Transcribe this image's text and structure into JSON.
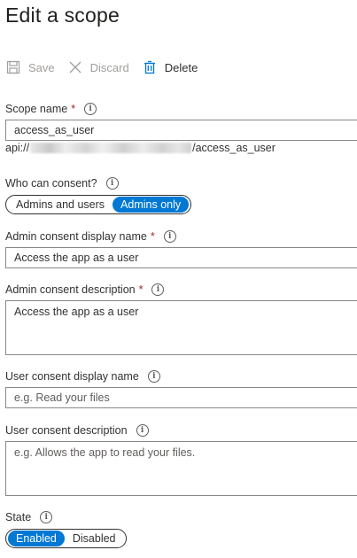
{
  "page": {
    "title": "Edit a scope"
  },
  "toolbar": {
    "save_label": "Save",
    "discard_label": "Discard",
    "delete_label": "Delete"
  },
  "scope_name": {
    "label": "Scope name",
    "required_mark": "*",
    "value": "access_as_user",
    "uri_prefix": "api://",
    "uri_suffix": "/access_as_user"
  },
  "who_can_consent": {
    "label": "Who can consent?",
    "options": [
      "Admins and users",
      "Admins only"
    ],
    "selected": "Admins only"
  },
  "admin_display_name": {
    "label": "Admin consent display name",
    "required_mark": "*",
    "value": "Access the app as a user"
  },
  "admin_description": {
    "label": "Admin consent description",
    "required_mark": "*",
    "value": "Access the app as a user"
  },
  "user_display_name": {
    "label": "User consent display name",
    "placeholder": "e.g. Read your files"
  },
  "user_description": {
    "label": "User consent description",
    "placeholder": "e.g. Allows the app to read your files."
  },
  "state": {
    "label": "State",
    "options": [
      "Enabled",
      "Disabled"
    ],
    "selected": "Enabled"
  },
  "info_glyph": "i",
  "colors": {
    "accent": "#0078d4",
    "required": "#a4262c",
    "disabled_text": "#a19f9d"
  }
}
